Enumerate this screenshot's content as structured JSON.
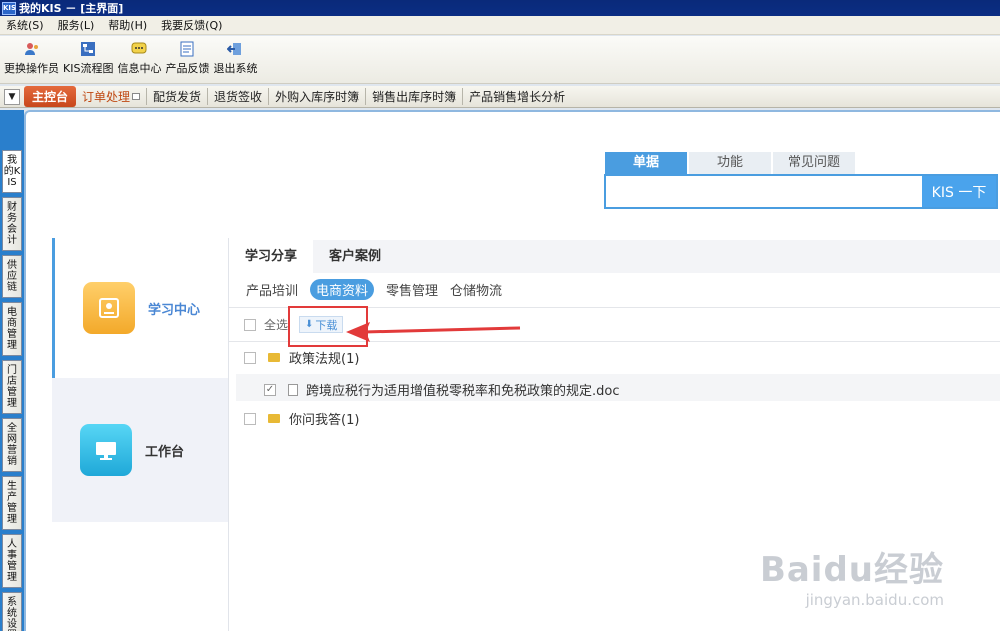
{
  "window": {
    "title": "我的KIS － [主界面]",
    "logo": "KIS"
  },
  "menu": [
    "系统(S)",
    "服务(L)",
    "帮助(H)",
    "我要反馈(Q)"
  ],
  "toolbar": [
    {
      "label": "更换操作员",
      "icon": "user-switch-icon"
    },
    {
      "label": "KIS流程图",
      "icon": "flowchart-icon"
    },
    {
      "label": "信息中心",
      "icon": "chat-icon"
    },
    {
      "label": "产品反馈",
      "icon": "feedback-icon"
    },
    {
      "label": "退出系统",
      "icon": "exit-icon"
    }
  ],
  "tabs": {
    "main": "主控台",
    "order": "订单处理",
    "others": [
      "配货发货",
      "退货签收",
      "外购入库序时簿",
      "销售出库序时簿",
      "产品销售增长分析"
    ]
  },
  "leftnav": [
    "我的KIS",
    "财务会计",
    "供应链",
    "电商管理",
    "门店管理",
    "全网营销",
    "生产管理",
    "人事管理",
    "系统设置"
  ],
  "search": {
    "tabs": [
      "单据",
      "功能",
      "常见问题"
    ],
    "value": "",
    "button": "KIS 一下"
  },
  "cards": [
    {
      "label": "学习中心",
      "icon": "study-center-icon"
    },
    {
      "label": "工作台",
      "icon": "workbench-icon"
    }
  ],
  "content_tabs": [
    "学习分享",
    "客户案例"
  ],
  "categories": [
    "产品培训",
    "电商资料",
    "零售管理",
    "仓储物流"
  ],
  "selectall": "全选",
  "download": "下载",
  "tree": {
    "folder1": "政策法规(1)",
    "file1": "跨境应税行为适用增值税零税率和免税政策的规定.doc",
    "folder2": "你问我答(1)"
  },
  "watermark": {
    "line1": "Baidu经验",
    "line2": "jingyan.baidu.com"
  },
  "colors": {
    "accent": "#4a9de0",
    "titlebar": "#0b2d83",
    "highlight": "#e23a3a"
  }
}
